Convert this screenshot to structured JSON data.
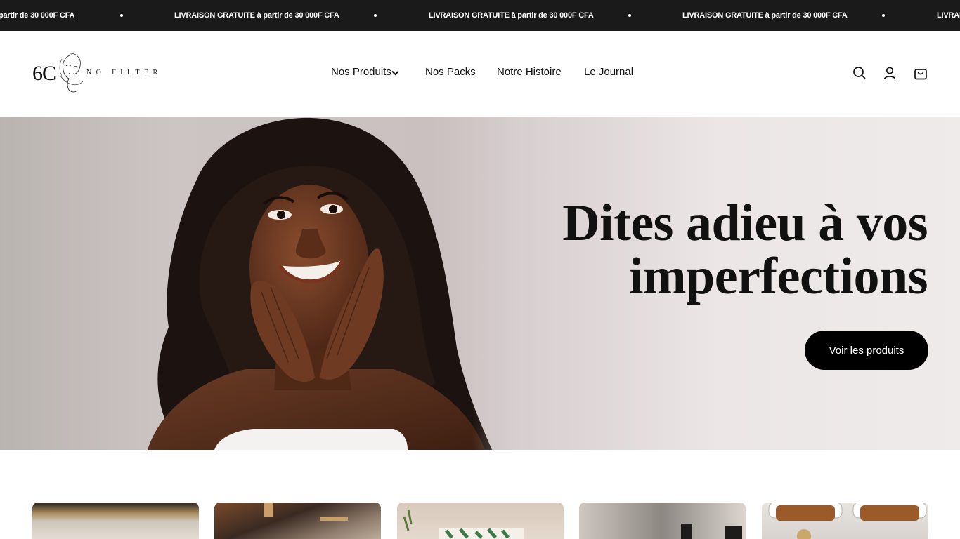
{
  "announcement": {
    "text": "LIVRAISON GRATUITE à partir de 30 000F CFA",
    "partial_left": "partir de 30 000F CFA",
    "partial_right": "LIVRAIS"
  },
  "brand": {
    "logo_mark": "6C",
    "logo_text": "NO FILTER"
  },
  "nav": {
    "products": "Nos Produits",
    "packs": "Nos Packs",
    "story": "Notre Histoire",
    "journal": "Le Journal"
  },
  "icons": [
    "search-icon",
    "account-icon",
    "cart-icon",
    "chevron-down-icon"
  ],
  "hero": {
    "title_line1": "Dites adieu à vos",
    "title_line2": "imperfections",
    "cta": "Voir les produits"
  },
  "colors": {
    "announcement_bg": "#1a1a1a",
    "cta_bg": "#000000",
    "hero_bg": "#e9e3e3"
  }
}
